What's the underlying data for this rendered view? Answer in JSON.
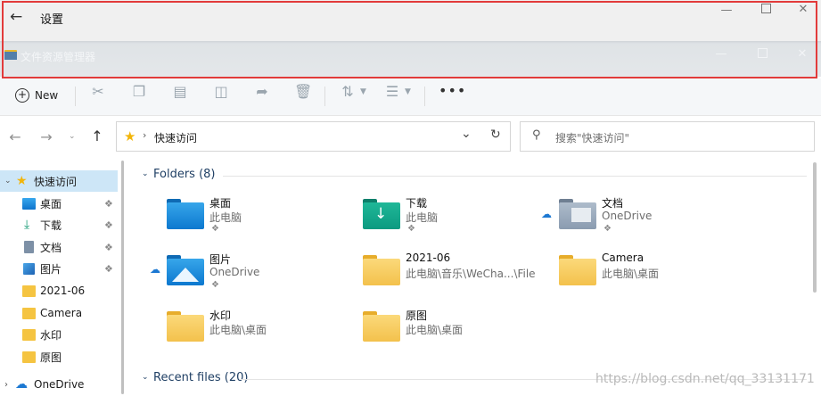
{
  "settings_bar": {
    "title": "设置"
  },
  "explorer_bar": {
    "title": "文件资源管理器"
  },
  "toolbar": {
    "new_label": "New"
  },
  "address": {
    "path_item": "快速访问"
  },
  "search": {
    "placeholder": "搜索\"快速访问\""
  },
  "sidebar": {
    "items": [
      {
        "label": "快速访问",
        "icon": "star-icon"
      },
      {
        "label": "桌面",
        "icon": "desktop-icon",
        "pinned": true
      },
      {
        "label": "下载",
        "icon": "download-icon",
        "pinned": true
      },
      {
        "label": "文档",
        "icon": "document-icon",
        "pinned": true
      },
      {
        "label": "图片",
        "icon": "picture-icon",
        "pinned": true
      },
      {
        "label": "2021-06",
        "icon": "folder-icon"
      },
      {
        "label": "Camera",
        "icon": "folder-icon"
      },
      {
        "label": "水印",
        "icon": "folder-icon"
      },
      {
        "label": "原图",
        "icon": "folder-icon"
      },
      {
        "label": "OneDrive",
        "icon": "cloud-icon"
      }
    ]
  },
  "folders": {
    "header": "Folders (8)",
    "items": [
      {
        "name": "桌面",
        "location": "此电脑",
        "icon": "desktop-folder-icon"
      },
      {
        "name": "下载",
        "location": "此电脑",
        "icon": "download-folder-icon"
      },
      {
        "name": "文档",
        "location": "OneDrive",
        "icon": "documents-folder-icon"
      },
      {
        "name": "图片",
        "location": "OneDrive",
        "icon": "pictures-folder-icon"
      },
      {
        "name": "2021-06",
        "location": "此电脑\\音乐\\WeCha...\\File",
        "icon": "folder-icon"
      },
      {
        "name": "Camera",
        "location": "此电脑\\桌面",
        "icon": "folder-icon"
      },
      {
        "name": "水印",
        "location": "此电脑\\桌面",
        "icon": "folder-icon"
      },
      {
        "name": "原图",
        "location": "此电脑\\桌面",
        "icon": "folder-icon"
      }
    ]
  },
  "recent": {
    "header": "Recent files (20)"
  },
  "watermark": "https://blog.csdn.net/qq_33131171",
  "colors": {
    "highlight": "#e23b3b",
    "selection": "#cde6f7",
    "group_header": "#1f3f64"
  }
}
